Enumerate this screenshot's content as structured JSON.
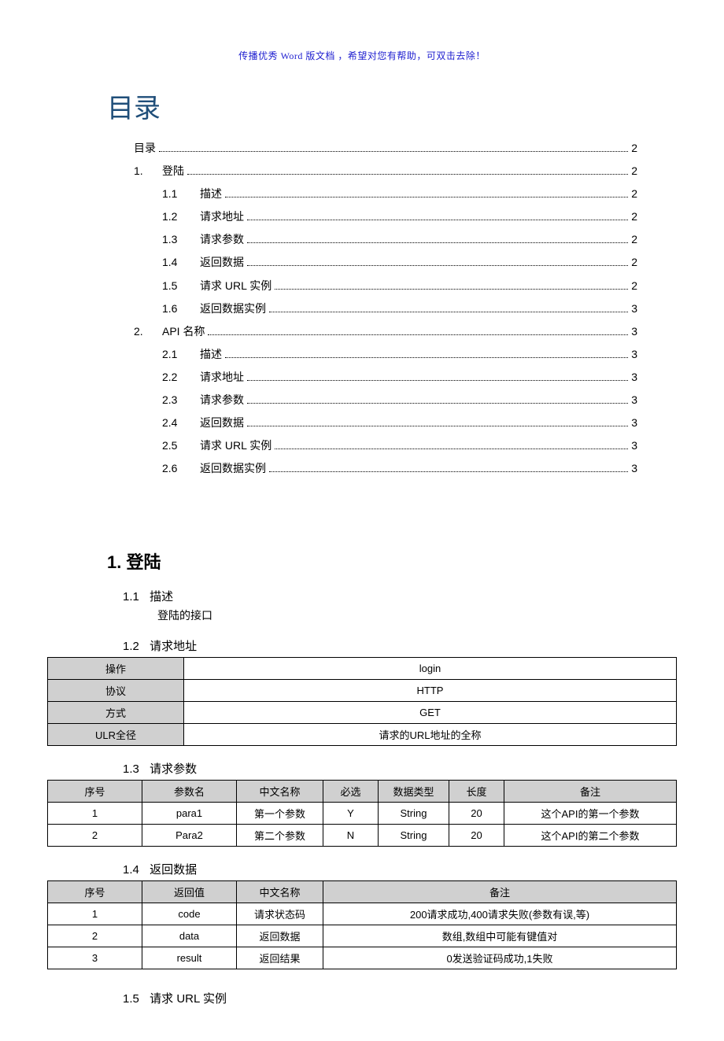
{
  "banner": "传播优秀 Word 版文档 ，希望对您有帮助，可双击去除！",
  "toc_title": "目录",
  "toc": {
    "items": [
      {
        "num": "",
        "label": "目录",
        "page": "2",
        "level": 0
      },
      {
        "num": "1.",
        "label": "登陆",
        "page": "2",
        "level": 0
      },
      {
        "num": "1.1",
        "label": "描述",
        "page": "2",
        "level": 1
      },
      {
        "num": "1.2",
        "label": "请求地址",
        "page": "2",
        "level": 1
      },
      {
        "num": "1.3",
        "label": "请求参数",
        "page": "2",
        "level": 1
      },
      {
        "num": "1.4",
        "label": "返回数据",
        "page": "2",
        "level": 1
      },
      {
        "num": "1.5",
        "label": "请求 URL 实例",
        "page": "2",
        "level": 1
      },
      {
        "num": "1.6",
        "label": "返回数据实例",
        "page": "3",
        "level": 1
      },
      {
        "num": "2.",
        "label": "API 名称",
        "page": "3",
        "level": 0
      },
      {
        "num": "2.1",
        "label": "描述",
        "page": "3",
        "level": 1
      },
      {
        "num": "2.2",
        "label": "请求地址",
        "page": "3",
        "level": 1
      },
      {
        "num": "2.3",
        "label": "请求参数",
        "page": "3",
        "level": 1
      },
      {
        "num": "2.4",
        "label": "返回数据",
        "page": "3",
        "level": 1
      },
      {
        "num": "2.5",
        "label": "请求 URL 实例",
        "page": "3",
        "level": 1
      },
      {
        "num": "2.6",
        "label": "返回数据实例",
        "page": "3",
        "level": 1
      }
    ]
  },
  "section1": {
    "heading": "1. 登陆",
    "s11_num": "1.1",
    "s11_label": "描述",
    "s11_desc": "登陆的接口",
    "s12_num": "1.2",
    "s12_label": "请求地址",
    "addr": {
      "h_op": "操作",
      "v_op": "login",
      "h_proto": "协议",
      "v_proto": "HTTP",
      "h_method": "方式",
      "v_method": "GET",
      "h_url": "ULR全径",
      "v_url": "请求的URL地址的全称"
    },
    "s13_num": "1.3",
    "s13_label": "请求参数",
    "param_headers": {
      "c1": "序号",
      "c2": "参数名",
      "c3": "中文名称",
      "c4": "必选",
      "c5": "数据类型",
      "c6": "长度",
      "c7": "备注"
    },
    "params": [
      {
        "no": "1",
        "name": "para1",
        "cn": "第一个参数",
        "req": "Y",
        "type": "String",
        "len": "20",
        "note": "这个API的第一个参数"
      },
      {
        "no": "2",
        "name": "Para2",
        "cn": "第二个参数",
        "req": "N",
        "type": "String",
        "len": "20",
        "note": "这个API的第二个参数"
      }
    ],
    "s14_num": "1.4",
    "s14_label": "返回数据",
    "ret_headers": {
      "c1": "序号",
      "c2": "返回值",
      "c3": "中文名称",
      "c4": "备注"
    },
    "returns": [
      {
        "no": "1",
        "name": "code",
        "cn": "请求状态码",
        "note": "200请求成功,400请求失败(参数有误,等)"
      },
      {
        "no": "2",
        "name": "data",
        "cn": "返回数据",
        "note": "数组,数组中可能有键值对"
      },
      {
        "no": "3",
        "name": "result",
        "cn": "返回结果",
        "note": "0发送验证码成功,1失败"
      }
    ],
    "s15_num": "1.5",
    "s15_label": "请求 URL 实例"
  }
}
